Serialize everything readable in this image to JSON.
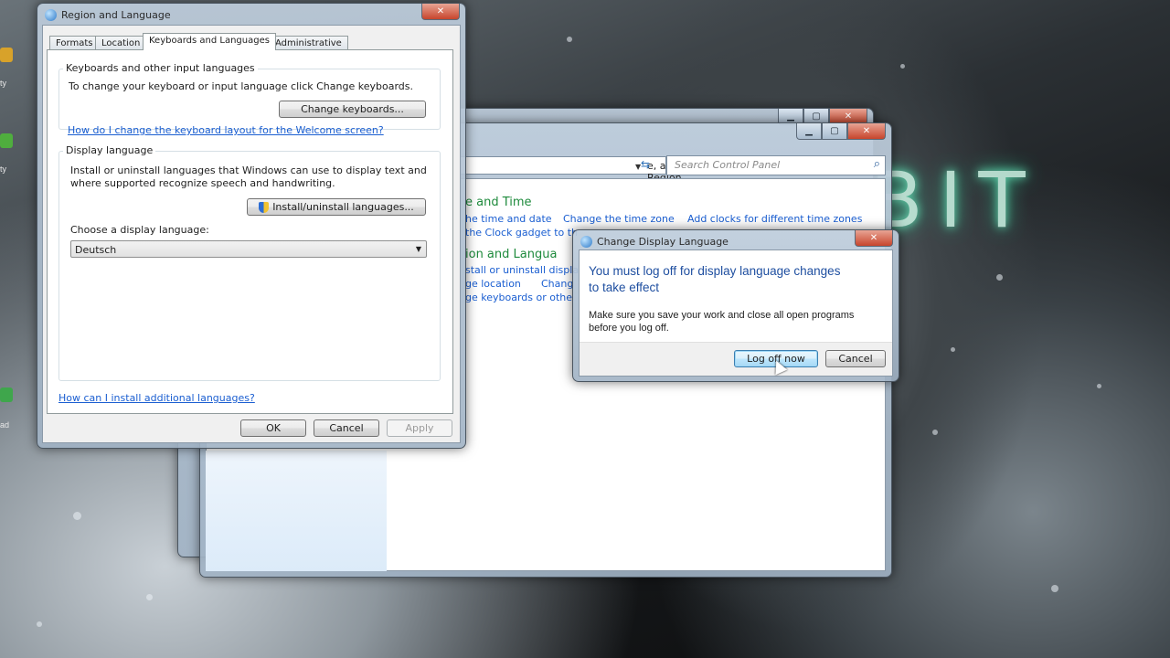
{
  "desktop": {
    "overlay_text": "BIT",
    "icon_labels": [
      "ty",
      "ty",
      "ad"
    ]
  },
  "control_panel": {
    "address": "e, and Region",
    "search_placeholder": "Search Control Panel",
    "sections": [
      {
        "heading": "e and Time",
        "links": [
          "he time and date",
          "Change the time zone",
          "Add clocks for different time zones",
          "the Clock gadget to th"
        ]
      },
      {
        "heading": "ion and Langua",
        "links": [
          "stall or uninstall displa",
          "ge location",
          "Chang",
          "ge keyboards or othe"
        ]
      }
    ]
  },
  "region_dialog": {
    "title": "Region and Language",
    "tabs": [
      "Formats",
      "Location",
      "Keyboards and Languages",
      "Administrative"
    ],
    "active_tab": "Keyboards and Languages",
    "keyboards_group": {
      "label": "Keyboards and other input languages",
      "description": "To change your keyboard or input language click Change keyboards.",
      "button": "Change keyboards...",
      "link": "How do I change the keyboard layout for the Welcome screen?"
    },
    "display_group": {
      "label": "Display language",
      "description_line1": "Install or uninstall languages that Windows can use to display text and",
      "description_line2": "where supported recognize speech and handwriting.",
      "button": "Install/uninstall languages...",
      "choose_label": "Choose a display language:",
      "selected_language": "Deutsch"
    },
    "bottom_link": "How can I install additional languages?",
    "buttons": {
      "ok": "OK",
      "cancel": "Cancel",
      "apply": "Apply"
    }
  },
  "change_language_dialog": {
    "title": "Change Display Language",
    "main_instruction_line1": "You must log off for display language changes",
    "main_instruction_line2": "to take effect",
    "content_line1": "Make sure you save your work and close all open programs",
    "content_line2": "before you log off.",
    "buttons": {
      "log_off": "Log off now",
      "cancel": "Cancel"
    }
  },
  "colors": {
    "link": "#1a5ed1",
    "heading_green": "#1e8a3c",
    "main_instruction": "#1f4fa0"
  }
}
